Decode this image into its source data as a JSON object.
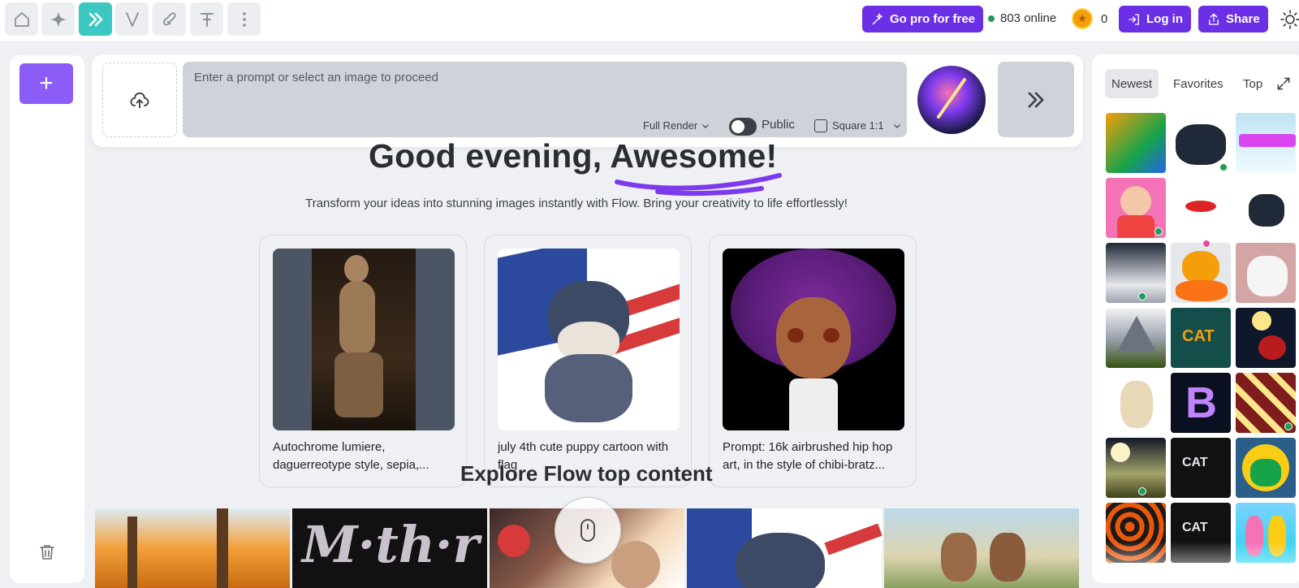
{
  "topbar": {
    "tools": [
      {
        "icon": "home-icon"
      },
      {
        "icon": "sparkle-icon"
      },
      {
        "icon": "double-chevron-icon",
        "active": true
      },
      {
        "icon": "v-letter-icon"
      },
      {
        "icon": "hand-brush-icon"
      },
      {
        "icon": "text-tool-icon"
      },
      {
        "icon": "more-vertical-icon"
      }
    ],
    "go_pro_label": "Go pro for free",
    "online_count": "803 online",
    "coins": "0",
    "login_label": "Log in",
    "share_label": "Share"
  },
  "prompt": {
    "placeholder": "Enter a prompt or select an image to proceed",
    "render_mode": "Full Render",
    "visibility_label": "Public",
    "aspect_label": "Square 1:1"
  },
  "hero": {
    "greeting_prefix": "Good evening, ",
    "greeting_name": "Awesome!",
    "subtitle": "Transform your ideas into stunning images instantly with Flow. Bring your creativity to life effortlessly!"
  },
  "cards": [
    {
      "caption": "Autochrome lumiere, daguerreotype style, sepia,..."
    },
    {
      "caption": "july 4th cute puppy cartoon with flag"
    },
    {
      "caption": "Prompt: 16k airbrushed hip hop art, in the style of chibi-bratz..."
    }
  ],
  "explore_title": "Explore Flow top content",
  "sidebar_tabs": [
    "Newest",
    "Favorites",
    "Top"
  ],
  "colors": {
    "brand_purple": "#6b2fe6",
    "accent_teal": "#3cc7c2",
    "online_green": "#1f9d55"
  }
}
